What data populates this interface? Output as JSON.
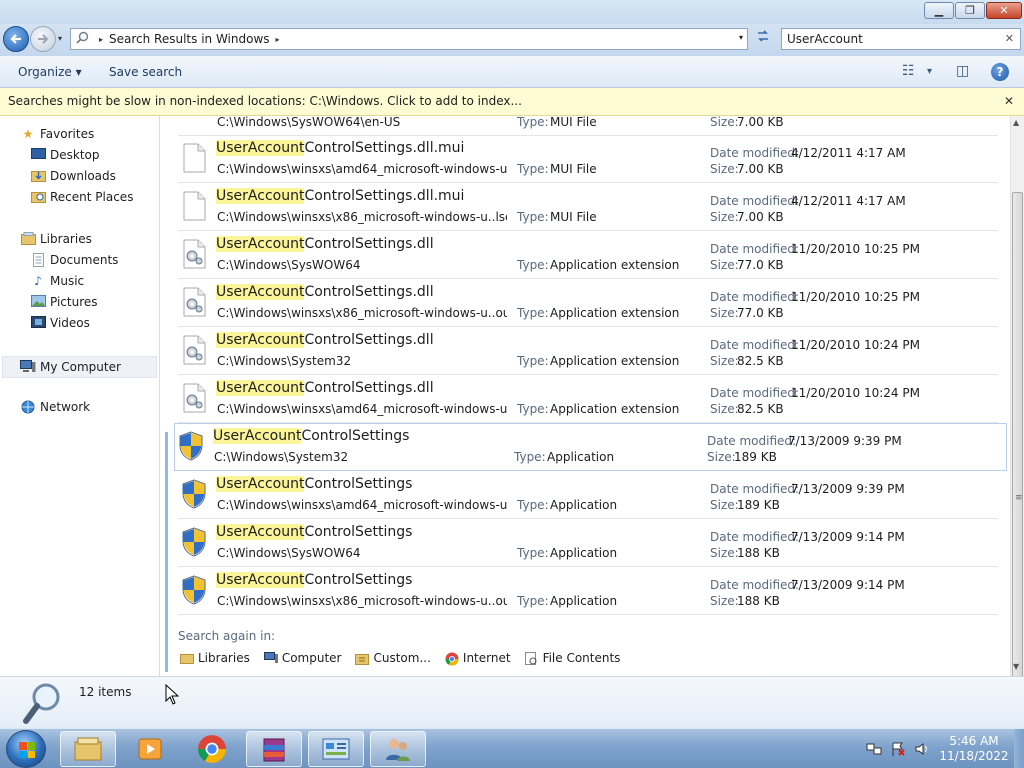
{
  "window": {
    "minimize_glyph": "▁",
    "maximize_glyph": "❐",
    "close_glyph": "✕"
  },
  "address": {
    "crumb": "Search Results in Windows",
    "separator_glyph": "▸",
    "dropdown_glyph": "▾"
  },
  "search": {
    "value": "UserAccount",
    "clear_glyph": "✕"
  },
  "toolbar": {
    "organize_label": "Organize ▾",
    "save_search_label": "Save search",
    "view_glyph": "☷",
    "view_dropdown_glyph": "▾",
    "preview_glyph": "◫",
    "help_glyph": "?"
  },
  "infobar": {
    "text": "Searches might be slow in non-indexed locations: C:\\Windows. Click to add to index...",
    "close_glyph": "✕"
  },
  "nav": {
    "favorites": "Favorites",
    "desktop": "Desktop",
    "downloads": "Downloads",
    "recent_places": "Recent Places",
    "libraries": "Libraries",
    "documents": "Documents",
    "music": "Music",
    "pictures": "Pictures",
    "videos": "Videos",
    "my_computer": "My Computer",
    "network": "Network"
  },
  "labels": {
    "type": "Type:",
    "date_modified": "Date modified:",
    "size": "Size:"
  },
  "results": [
    {
      "highlight": "",
      "rest": "",
      "path": "C:\\Windows\\SysWOW64\\en-US",
      "type": "MUI File",
      "date": "",
      "size": "7.00 KB",
      "icon": "doc-icon",
      "partial": true
    },
    {
      "highlight": "UserAccount",
      "rest": "ControlSettings.dll.mui",
      "path": "C:\\Windows\\winsxs\\amd64_microsoft-windows-u..l...",
      "type": "MUI File",
      "date": "4/12/2011 4:17 AM",
      "size": "7.00 KB",
      "icon": "doc-icon"
    },
    {
      "highlight": "UserAccount",
      "rest": "ControlSettings.dll.mui",
      "path": "C:\\Windows\\winsxs\\x86_microsoft-windows-u..lsetti...",
      "type": "MUI File",
      "date": "4/12/2011 4:17 AM",
      "size": "7.00 KB",
      "icon": "doc-icon"
    },
    {
      "highlight": "UserAccount",
      "rest": "ControlSettings.dll",
      "path": "C:\\Windows\\SysWOW64",
      "type": "Application extension",
      "date": "11/20/2010 10:25 PM",
      "size": "77.0 KB",
      "icon": "dll-icon"
    },
    {
      "highlight": "UserAccount",
      "rest": "ControlSettings.dll",
      "path": "C:\\Windows\\winsxs\\x86_microsoft-windows-u..ount...",
      "type": "Application extension",
      "date": "11/20/2010 10:25 PM",
      "size": "77.0 KB",
      "icon": "dll-icon"
    },
    {
      "highlight": "UserAccount",
      "rest": "ControlSettings.dll",
      "path": "C:\\Windows\\System32",
      "type": "Application extension",
      "date": "11/20/2010 10:24 PM",
      "size": "82.5 KB",
      "icon": "dll-icon"
    },
    {
      "highlight": "UserAccount",
      "rest": "ControlSettings.dll",
      "path": "C:\\Windows\\winsxs\\amd64_microsoft-windows-u.....",
      "type": "Application extension",
      "date": "11/20/2010 10:24 PM",
      "size": "82.5 KB",
      "icon": "dll-icon"
    },
    {
      "highlight": "UserAccount",
      "rest": "ControlSettings",
      "path": "C:\\Windows\\System32",
      "type": "Application",
      "date": "7/13/2009 9:39 PM",
      "size": "189 KB",
      "icon": "uac-shield-icon",
      "selected": true
    },
    {
      "highlight": "UserAccount",
      "rest": "ControlSettings",
      "path": "C:\\Windows\\winsxs\\amd64_microsoft-windows-u.....",
      "type": "Application",
      "date": "7/13/2009 9:39 PM",
      "size": "189 KB",
      "icon": "uac-shield-icon"
    },
    {
      "highlight": "UserAccount",
      "rest": "ControlSettings",
      "path": "C:\\Windows\\SysWOW64",
      "type": "Application",
      "date": "7/13/2009 9:14 PM",
      "size": "188 KB",
      "icon": "uac-shield-icon"
    },
    {
      "highlight": "UserAccount",
      "rest": "ControlSettings",
      "path": "C:\\Windows\\winsxs\\x86_microsoft-windows-u..ount...",
      "type": "Application",
      "date": "7/13/2009 9:14 PM",
      "size": "188 KB",
      "icon": "uac-shield-icon"
    }
  ],
  "search_again": {
    "heading": "Search again in:",
    "libraries": "Libraries",
    "computer": "Computer",
    "custom": "Custom...",
    "internet": "Internet",
    "file_contents": "File Contents"
  },
  "details": {
    "item_count": "12 items"
  },
  "scrollbar": {
    "up_glyph": "▲",
    "down_glyph": "▼",
    "grip_glyph": "≡"
  },
  "taskbar": {
    "time": "5:46 AM",
    "date": "11/18/2022",
    "apps": [
      "windows-explorer-icon",
      "media-player-icon",
      "chrome-icon",
      "winrar-icon",
      "control-panel-icon",
      "user-accounts-icon"
    ]
  },
  "colors": {
    "highlight": "#fbf59a",
    "infobar_bg": "#fffbd3",
    "selection_border": "#b8d0ea"
  }
}
